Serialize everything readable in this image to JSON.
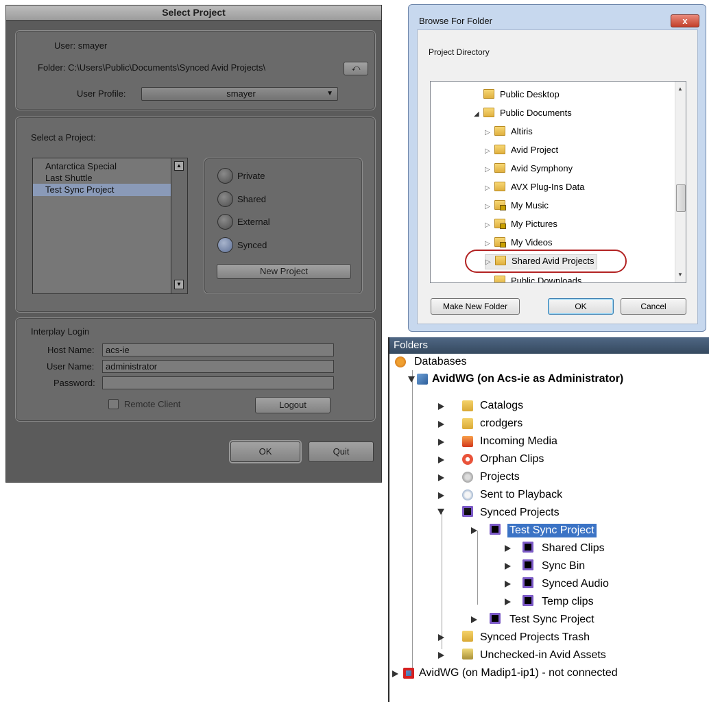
{
  "select_project": {
    "title": "Select Project",
    "user_label": "User:",
    "user_value": "smayer",
    "folder_label": "Folder:",
    "folder_value": "C:\\Users\\Public\\Documents\\Synced Avid Projects\\",
    "user_profile_label": "User Profile:",
    "user_profile_value": "smayer",
    "select_label": "Select a Project:",
    "projects": [
      "Antarctica Special",
      "Last Shuttle",
      "Test Sync Project"
    ],
    "selected_project": "Test Sync Project",
    "types": [
      "Private",
      "Shared",
      "External",
      "Synced"
    ],
    "selected_type": "Synced",
    "new_project": "New Project",
    "interplay_title": "Interplay Login",
    "host_label": "Host Name:",
    "host_value": "acs-ie",
    "username_label": "User Name:",
    "username_value": "administrator",
    "password_label": "Password:",
    "password_value": "",
    "remote_client": "Remote Client",
    "logout": "Logout",
    "ok": "OK",
    "quit": "Quit"
  },
  "browse": {
    "title": "Browse For Folder",
    "close": "x",
    "prompt": "Project Directory",
    "items": [
      {
        "label": "Public Desktop",
        "icon": "folder-icon"
      },
      {
        "label": "Public Documents",
        "icon": "folder-icon"
      },
      {
        "label": "Altiris",
        "icon": "folder-icon"
      },
      {
        "label": "Avid Project",
        "icon": "folder-icon"
      },
      {
        "label": "Avid Symphony",
        "icon": "folder-icon"
      },
      {
        "label": "AVX Plug-Ins Data",
        "icon": "folder-icon"
      },
      {
        "label": "My Music",
        "icon": "locked-folder-icon"
      },
      {
        "label": "My Pictures",
        "icon": "locked-folder-icon"
      },
      {
        "label": "My Videos",
        "icon": "locked-folder-icon"
      },
      {
        "label": "Shared Avid Projects",
        "icon": "folder-icon"
      },
      {
        "label": "Public Downloads",
        "icon": "folder-icon"
      }
    ],
    "make_new_folder": "Make New Folder",
    "ok": "OK",
    "cancel": "Cancel"
  },
  "folders": {
    "header": "Folders",
    "databases": "Databases",
    "db1": "AvidWG (on Acs-ie as Administrator)",
    "items": [
      "Catalogs",
      "crodgers",
      "Incoming Media",
      "Orphan Clips",
      "Projects",
      "Sent to Playback",
      "Synced Projects"
    ],
    "synced_children": [
      "Test Sync Project"
    ],
    "project_children": [
      "Shared Clips",
      "Sync  Bin",
      "Synced Audio",
      "Temp clips"
    ],
    "second_project": "Test Sync Project",
    "after": [
      "Synced Projects Trash",
      "Unchecked-in Avid Assets"
    ],
    "db2": "AvidWG (on Madip1-ip1)  - not connected"
  }
}
